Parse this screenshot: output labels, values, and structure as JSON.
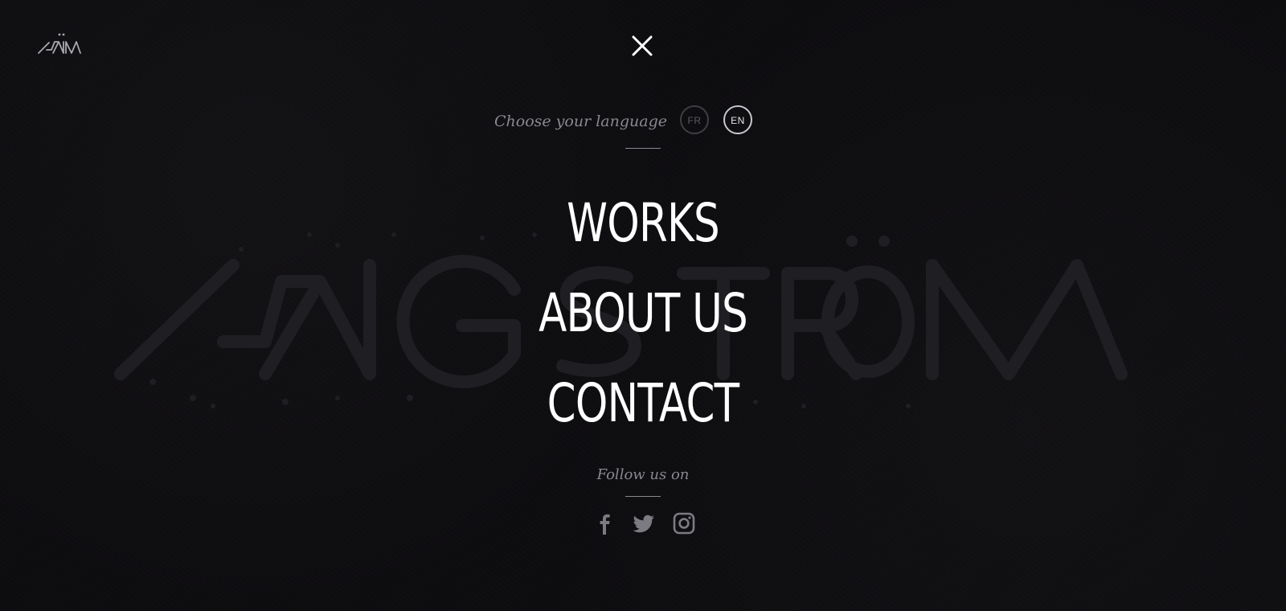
{
  "brand": {
    "watermark": "ANGSTRÖM"
  },
  "language": {
    "label": "Choose your language",
    "options": [
      {
        "code": "FR",
        "active": false
      },
      {
        "code": "EN",
        "active": true
      }
    ]
  },
  "menu": {
    "items": [
      {
        "label": "WORKS"
      },
      {
        "label": "ABOUT US"
      },
      {
        "label": "CONTACT"
      }
    ]
  },
  "follow": {
    "label": "Follow us on",
    "socials": [
      {
        "name": "facebook-icon"
      },
      {
        "name": "twitter-icon"
      },
      {
        "name": "instagram-icon"
      }
    ]
  },
  "icons": {
    "close": "close-icon",
    "logo": "angstrom-logo-icon"
  },
  "colors": {
    "background": "#0d0c0f",
    "text": "#ffffff",
    "muted": "#8a8890",
    "icon": "#7c7b82"
  }
}
